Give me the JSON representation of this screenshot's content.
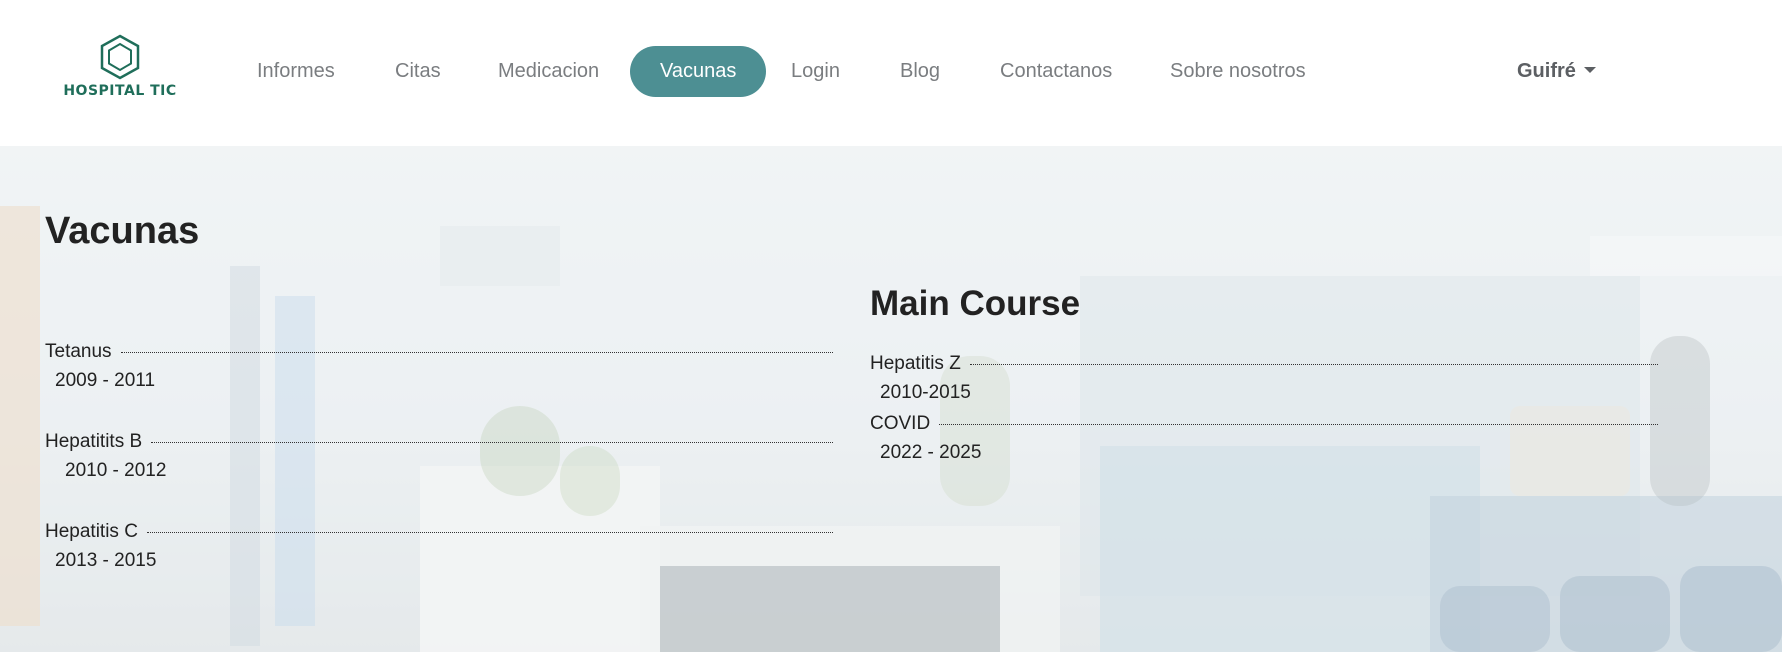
{
  "brand": {
    "logo_text": "HOSPITAL TIC"
  },
  "nav": {
    "items": [
      {
        "label": "Informes"
      },
      {
        "label": "Citas"
      },
      {
        "label": "Medicacion"
      },
      {
        "label": "Vacunas"
      },
      {
        "label": "Login"
      },
      {
        "label": "Blog"
      },
      {
        "label": "Contactanos"
      },
      {
        "label": "Sobre nosotros"
      }
    ],
    "user": "Guifré"
  },
  "page": {
    "title": "Vacunas",
    "left_list": [
      {
        "name": "Tetanus",
        "years": "2009 - 2011"
      },
      {
        "name": "Hepatitits B",
        "years": "2010 - 2012"
      },
      {
        "name": "Hepatitis C",
        "years": "2013 - 2015"
      }
    ],
    "section_title": "Main Course",
    "right_list": [
      {
        "name": "Hepatitis Z",
        "years": "2010-2015"
      },
      {
        "name": "COVID",
        "years": "2022 - 2025"
      }
    ]
  },
  "colors": {
    "accent": "#4d8f93",
    "logo": "#1f6e5a"
  }
}
